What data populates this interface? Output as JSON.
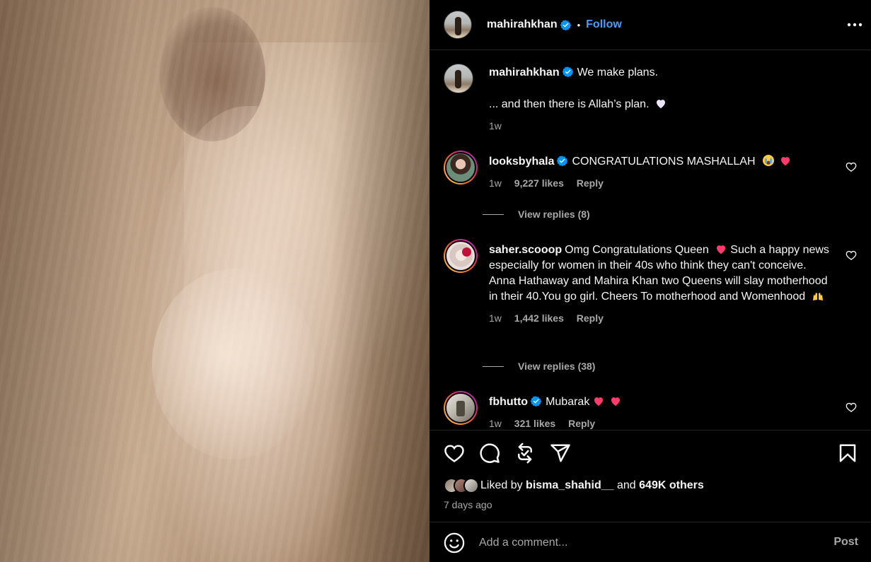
{
  "owner": {
    "username": "mahirahkhan",
    "follow_label": "Follow"
  },
  "caption": {
    "username": "mahirahkhan",
    "line1": "We make plans.",
    "line2": "... and then there is Allah’s plan.",
    "time": "1w"
  },
  "comments": [
    {
      "username": "looksbyhala",
      "verified": true,
      "text": "CONGRATULATIONS MASHALLAH",
      "time": "1w",
      "likes": "9,227 likes",
      "reply": "Reply",
      "view_replies": "View replies (8)"
    },
    {
      "username": "saher.scooop",
      "verified": false,
      "text_part1": "Omg Congratulations Queen",
      "text_part2": "Such a happy news especially for women in their 40s who think they can't conceive. Anna Hathaway and Mahira Khan two Queens will slay motherhood in their 40.You go girl. Cheers To motherhood and Womenhood",
      "time": "1w",
      "likes": "1,442 likes",
      "reply": "Reply",
      "view_replies": "View replies (38)"
    },
    {
      "username": "fbhutto",
      "verified": true,
      "text": "Mubarak",
      "time": "1w",
      "likes": "321 likes",
      "reply": "Reply"
    }
  ],
  "likes_summary": {
    "prefix": "Liked by",
    "user": "bisma_shahid__",
    "conjunction": "and",
    "others": "649K others"
  },
  "date": "7 days ago",
  "comment_box": {
    "placeholder": "Add a comment...",
    "post_label": "Post"
  },
  "colors": {
    "background": "#000000",
    "accent_link": "#4a9cf6",
    "verified": "#0095f6",
    "muted_text": "#a8a8a8",
    "heart_emoji": "#ff3b6b"
  }
}
